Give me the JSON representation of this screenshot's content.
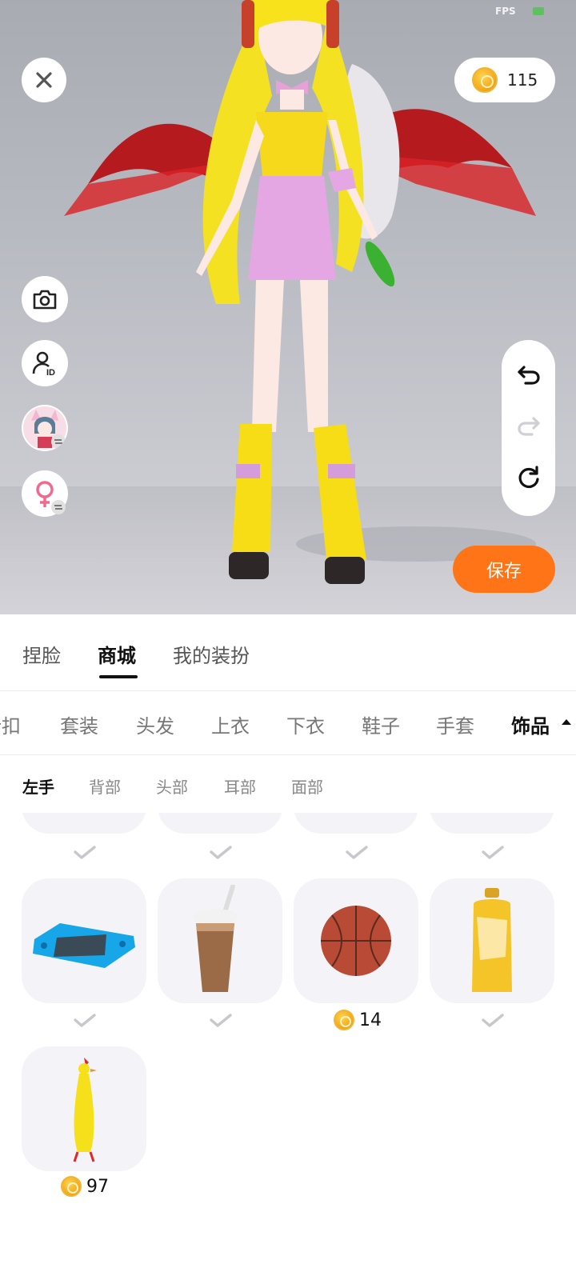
{
  "status": {
    "fps_label": "FPS"
  },
  "topbar": {
    "close_icon": "close-icon",
    "coin_balance": "115"
  },
  "left_tools": [
    {
      "icon": "camera-icon"
    },
    {
      "icon": "user-id-icon",
      "badge": "ID"
    },
    {
      "icon": "avatar-switch-icon"
    },
    {
      "icon": "female-gender-switch-icon"
    }
  ],
  "right_tools": [
    {
      "icon": "undo-icon",
      "enabled": true
    },
    {
      "icon": "redo-icon",
      "enabled": false
    },
    {
      "icon": "reset-icon",
      "enabled": true
    }
  ],
  "save_label": "保存",
  "main_tabs": [
    {
      "label": "捏脸",
      "active": false
    },
    {
      "label": "商城",
      "active": true
    },
    {
      "label": "我的装扮",
      "active": false
    }
  ],
  "categories": [
    {
      "label": "折扣",
      "active": false
    },
    {
      "label": "套装",
      "active": false
    },
    {
      "label": "头发",
      "active": false
    },
    {
      "label": "上衣",
      "active": false
    },
    {
      "label": "下衣",
      "active": false
    },
    {
      "label": "鞋子",
      "active": false
    },
    {
      "label": "手套",
      "active": false
    },
    {
      "label": "饰品",
      "active": true
    }
  ],
  "subcategories": [
    {
      "label": "左手",
      "active": true
    },
    {
      "label": "背部",
      "active": false
    },
    {
      "label": "头部",
      "active": false
    },
    {
      "label": "耳部",
      "active": false
    },
    {
      "label": "面部",
      "active": false
    }
  ],
  "items": [
    {
      "name": "handheld-game-console",
      "owned": true,
      "price": ""
    },
    {
      "name": "coffee-cup",
      "owned": true,
      "price": ""
    },
    {
      "name": "basketball",
      "owned": false,
      "price": "14"
    },
    {
      "name": "juice-bottle",
      "owned": true,
      "price": ""
    },
    {
      "name": "rubber-chicken",
      "owned": false,
      "price": "97"
    }
  ],
  "colors": {
    "accent": "#ff7417",
    "text": "#111111",
    "muted": "#777777",
    "card": "#f4f4f8"
  }
}
